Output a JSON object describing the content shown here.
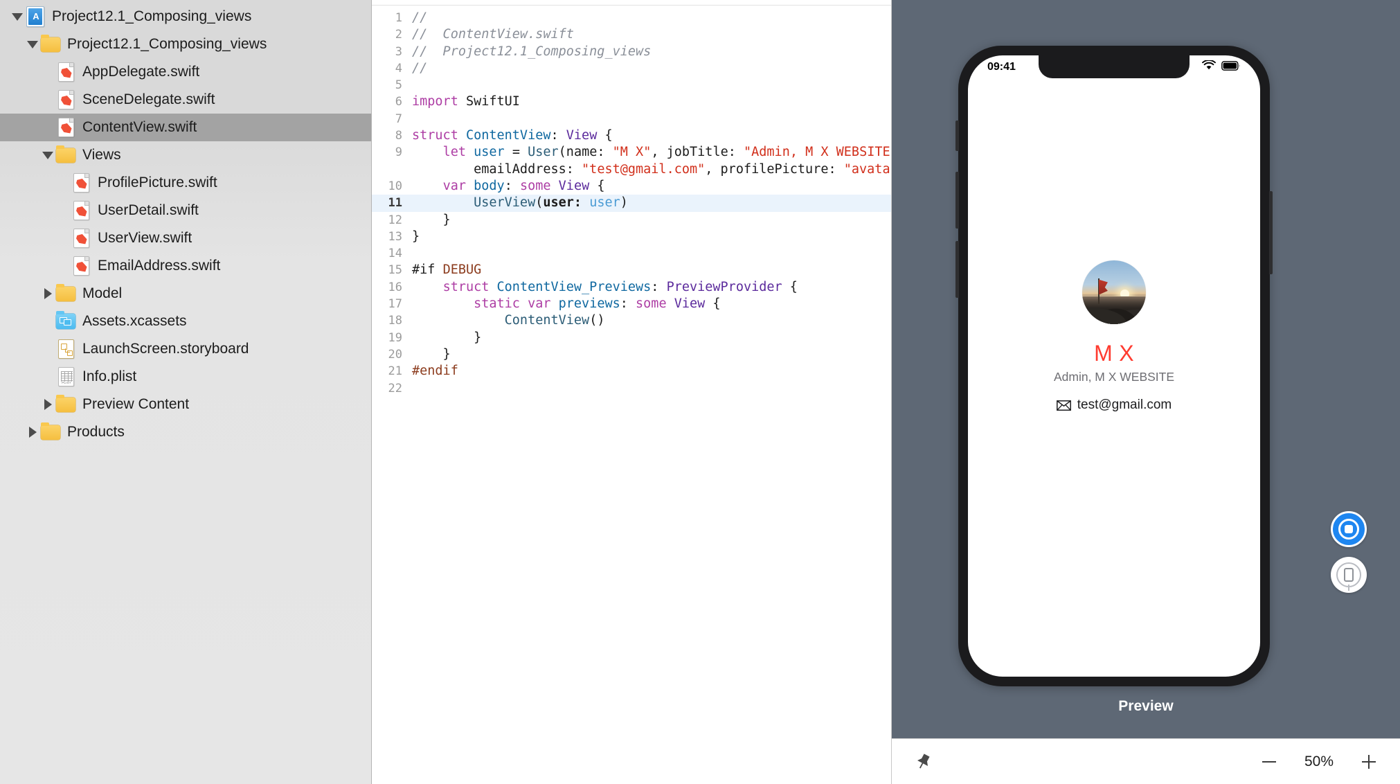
{
  "navigator": {
    "items": [
      {
        "label": "Project12.1_Composing_views",
        "icon": "xcode-project-icon",
        "indent": 0,
        "twisty": "down",
        "selected": false
      },
      {
        "label": "Project12.1_Composing_views",
        "icon": "folder-icon",
        "indent": 1,
        "twisty": "down",
        "selected": false
      },
      {
        "label": "AppDelegate.swift",
        "icon": "swift-file-icon",
        "indent": 2,
        "twisty": "none",
        "selected": false
      },
      {
        "label": "SceneDelegate.swift",
        "icon": "swift-file-icon",
        "indent": 2,
        "twisty": "none",
        "selected": false
      },
      {
        "label": "ContentView.swift",
        "icon": "swift-file-icon",
        "indent": 2,
        "twisty": "none",
        "selected": true
      },
      {
        "label": "Views",
        "icon": "folder-icon",
        "indent": 2,
        "twisty": "down",
        "selected": false
      },
      {
        "label": "ProfilePicture.swift",
        "icon": "swift-file-icon",
        "indent": 3,
        "twisty": "none",
        "selected": false
      },
      {
        "label": "UserDetail.swift",
        "icon": "swift-file-icon",
        "indent": 3,
        "twisty": "none",
        "selected": false
      },
      {
        "label": "UserView.swift",
        "icon": "swift-file-icon",
        "indent": 3,
        "twisty": "none",
        "selected": false
      },
      {
        "label": "EmailAddress.swift",
        "icon": "swift-file-icon",
        "indent": 3,
        "twisty": "none",
        "selected": false
      },
      {
        "label": "Model",
        "icon": "folder-icon",
        "indent": 2,
        "twisty": "right",
        "selected": false
      },
      {
        "label": "Assets.xcassets",
        "icon": "xcassets-icon",
        "indent": 2,
        "twisty": "none",
        "selected": false
      },
      {
        "label": "LaunchScreen.storyboard",
        "icon": "storyboard-icon",
        "indent": 2,
        "twisty": "none",
        "selected": false
      },
      {
        "label": "Info.plist",
        "icon": "plist-icon",
        "indent": 2,
        "twisty": "none",
        "selected": false
      },
      {
        "label": "Preview Content",
        "icon": "folder-icon",
        "indent": 2,
        "twisty": "right",
        "selected": false
      },
      {
        "label": "Products",
        "icon": "folder-icon",
        "indent": 1,
        "twisty": "right",
        "selected": false
      }
    ]
  },
  "editor": {
    "filename": "ContentView.swift",
    "highlighted_line": 11,
    "lines": [
      {
        "n": "1",
        "tokens": [
          {
            "t": "//",
            "c": "c-com"
          }
        ]
      },
      {
        "n": "2",
        "tokens": [
          {
            "t": "//  ContentView.swift",
            "c": "c-com"
          }
        ]
      },
      {
        "n": "3",
        "tokens": [
          {
            "t": "//  Project12.1_Composing_views",
            "c": "c-com"
          }
        ]
      },
      {
        "n": "4",
        "tokens": [
          {
            "t": "//",
            "c": "c-com"
          }
        ]
      },
      {
        "n": "5",
        "tokens": []
      },
      {
        "n": "6",
        "tokens": [
          {
            "t": "import",
            "c": "c-kw"
          },
          {
            "t": " SwiftUI",
            "c": "c-plain"
          }
        ]
      },
      {
        "n": "7",
        "tokens": []
      },
      {
        "n": "8",
        "tokens": [
          {
            "t": "struct",
            "c": "c-kw"
          },
          {
            "t": " ",
            "c": "c-plain"
          },
          {
            "t": "ContentView",
            "c": "c-type"
          },
          {
            "t": ": ",
            "c": "c-plain"
          },
          {
            "t": "View",
            "c": "c-proto"
          },
          {
            "t": " {",
            "c": "c-plain"
          }
        ]
      },
      {
        "n": "9",
        "tokens": [
          {
            "t": "    ",
            "c": "c-plain"
          },
          {
            "t": "let",
            "c": "c-kw"
          },
          {
            "t": " ",
            "c": "c-plain"
          },
          {
            "t": "user",
            "c": "c-type"
          },
          {
            "t": " = ",
            "c": "c-plain"
          },
          {
            "t": "User",
            "c": "c-typedark"
          },
          {
            "t": "(name: ",
            "c": "c-plain"
          },
          {
            "t": "\"M X\"",
            "c": "c-str"
          },
          {
            "t": ", jobTitle: ",
            "c": "c-plain"
          },
          {
            "t": "\"Admin, M X WEBSITE\"",
            "c": "c-str"
          },
          {
            "t": ",",
            "c": "c-plain"
          }
        ]
      },
      {
        "n": "",
        "wrap": true,
        "tokens": [
          {
            "t": "        emailAddress: ",
            "c": "c-plain"
          },
          {
            "t": "\"test@gmail.com\"",
            "c": "c-str"
          },
          {
            "t": ", profilePicture: ",
            "c": "c-plain"
          },
          {
            "t": "\"avatar\"",
            "c": "c-str"
          },
          {
            "t": ")",
            "c": "c-plain"
          }
        ]
      },
      {
        "n": "10",
        "tokens": [
          {
            "t": "    ",
            "c": "c-plain"
          },
          {
            "t": "var",
            "c": "c-kw"
          },
          {
            "t": " ",
            "c": "c-plain"
          },
          {
            "t": "body",
            "c": "c-type"
          },
          {
            "t": ": ",
            "c": "c-plain"
          },
          {
            "t": "some",
            "c": "c-kw"
          },
          {
            "t": " ",
            "c": "c-plain"
          },
          {
            "t": "View",
            "c": "c-proto"
          },
          {
            "t": " {",
            "c": "c-plain"
          }
        ]
      },
      {
        "n": "11",
        "tokens": [
          {
            "t": "        ",
            "c": "c-plain"
          },
          {
            "t": "UserView",
            "c": "c-typedark"
          },
          {
            "t": "(",
            "c": "c-plain"
          },
          {
            "t": "user:",
            "c": "c-param"
          },
          {
            "t": " ",
            "c": "c-plain"
          },
          {
            "t": "user",
            "c": "c-var"
          },
          {
            "t": ")",
            "c": "c-plain"
          }
        ]
      },
      {
        "n": "12",
        "tokens": [
          {
            "t": "    }",
            "c": "c-plain"
          }
        ]
      },
      {
        "n": "13",
        "tokens": [
          {
            "t": "}",
            "c": "c-plain"
          }
        ]
      },
      {
        "n": "14",
        "tokens": []
      },
      {
        "n": "15",
        "tokens": [
          {
            "t": "#if",
            "c": "c-plain"
          },
          {
            "t": " ",
            "c": "c-plain"
          },
          {
            "t": "DEBUG",
            "c": "c-pre"
          }
        ]
      },
      {
        "n": "16",
        "tokens": [
          {
            "t": "    ",
            "c": "c-plain"
          },
          {
            "t": "struct",
            "c": "c-kw"
          },
          {
            "t": " ",
            "c": "c-plain"
          },
          {
            "t": "ContentView_Previews",
            "c": "c-type"
          },
          {
            "t": ": ",
            "c": "c-plain"
          },
          {
            "t": "PreviewProvider",
            "c": "c-proto"
          },
          {
            "t": " {",
            "c": "c-plain"
          }
        ]
      },
      {
        "n": "17",
        "tokens": [
          {
            "t": "        ",
            "c": "c-plain"
          },
          {
            "t": "static",
            "c": "c-kw"
          },
          {
            "t": " ",
            "c": "c-plain"
          },
          {
            "t": "var",
            "c": "c-kw"
          },
          {
            "t": " ",
            "c": "c-plain"
          },
          {
            "t": "previews",
            "c": "c-type"
          },
          {
            "t": ": ",
            "c": "c-plain"
          },
          {
            "t": "some",
            "c": "c-kw"
          },
          {
            "t": " ",
            "c": "c-plain"
          },
          {
            "t": "View",
            "c": "c-proto"
          },
          {
            "t": " {",
            "c": "c-plain"
          }
        ]
      },
      {
        "n": "18",
        "tokens": [
          {
            "t": "            ",
            "c": "c-plain"
          },
          {
            "t": "ContentView",
            "c": "c-typedark"
          },
          {
            "t": "()",
            "c": "c-plain"
          }
        ]
      },
      {
        "n": "19",
        "tokens": [
          {
            "t": "        }",
            "c": "c-plain"
          }
        ]
      },
      {
        "n": "20",
        "tokens": [
          {
            "t": "    }",
            "c": "c-plain"
          }
        ]
      },
      {
        "n": "21",
        "tokens": [
          {
            "t": "#endif",
            "c": "c-pre"
          }
        ]
      },
      {
        "n": "22",
        "tokens": []
      }
    ]
  },
  "preview": {
    "label": "Preview",
    "status_bar": {
      "time": "09:41",
      "wifi_icon": "wifi-icon",
      "battery_icon": "battery-icon"
    },
    "user_card": {
      "avatar_icon": "profile-avatar-image",
      "name": "M X",
      "name_color": "#ff3b30",
      "job_title": "Admin, M X WEBSITE",
      "email_icon": "envelope-icon",
      "email": "test@gmail.com"
    },
    "buttons": {
      "live_preview_icon": "live-preview-icon",
      "inspect_icon": "inspect-device-icon",
      "accent_color": "#1e86f0"
    },
    "bottom_bar": {
      "pin_icon": "pin-icon",
      "zoom_out_icon": "minus-icon",
      "zoom_level": "50%",
      "zoom_in_icon": "plus-icon"
    },
    "canvas_color": "#5e6875"
  }
}
